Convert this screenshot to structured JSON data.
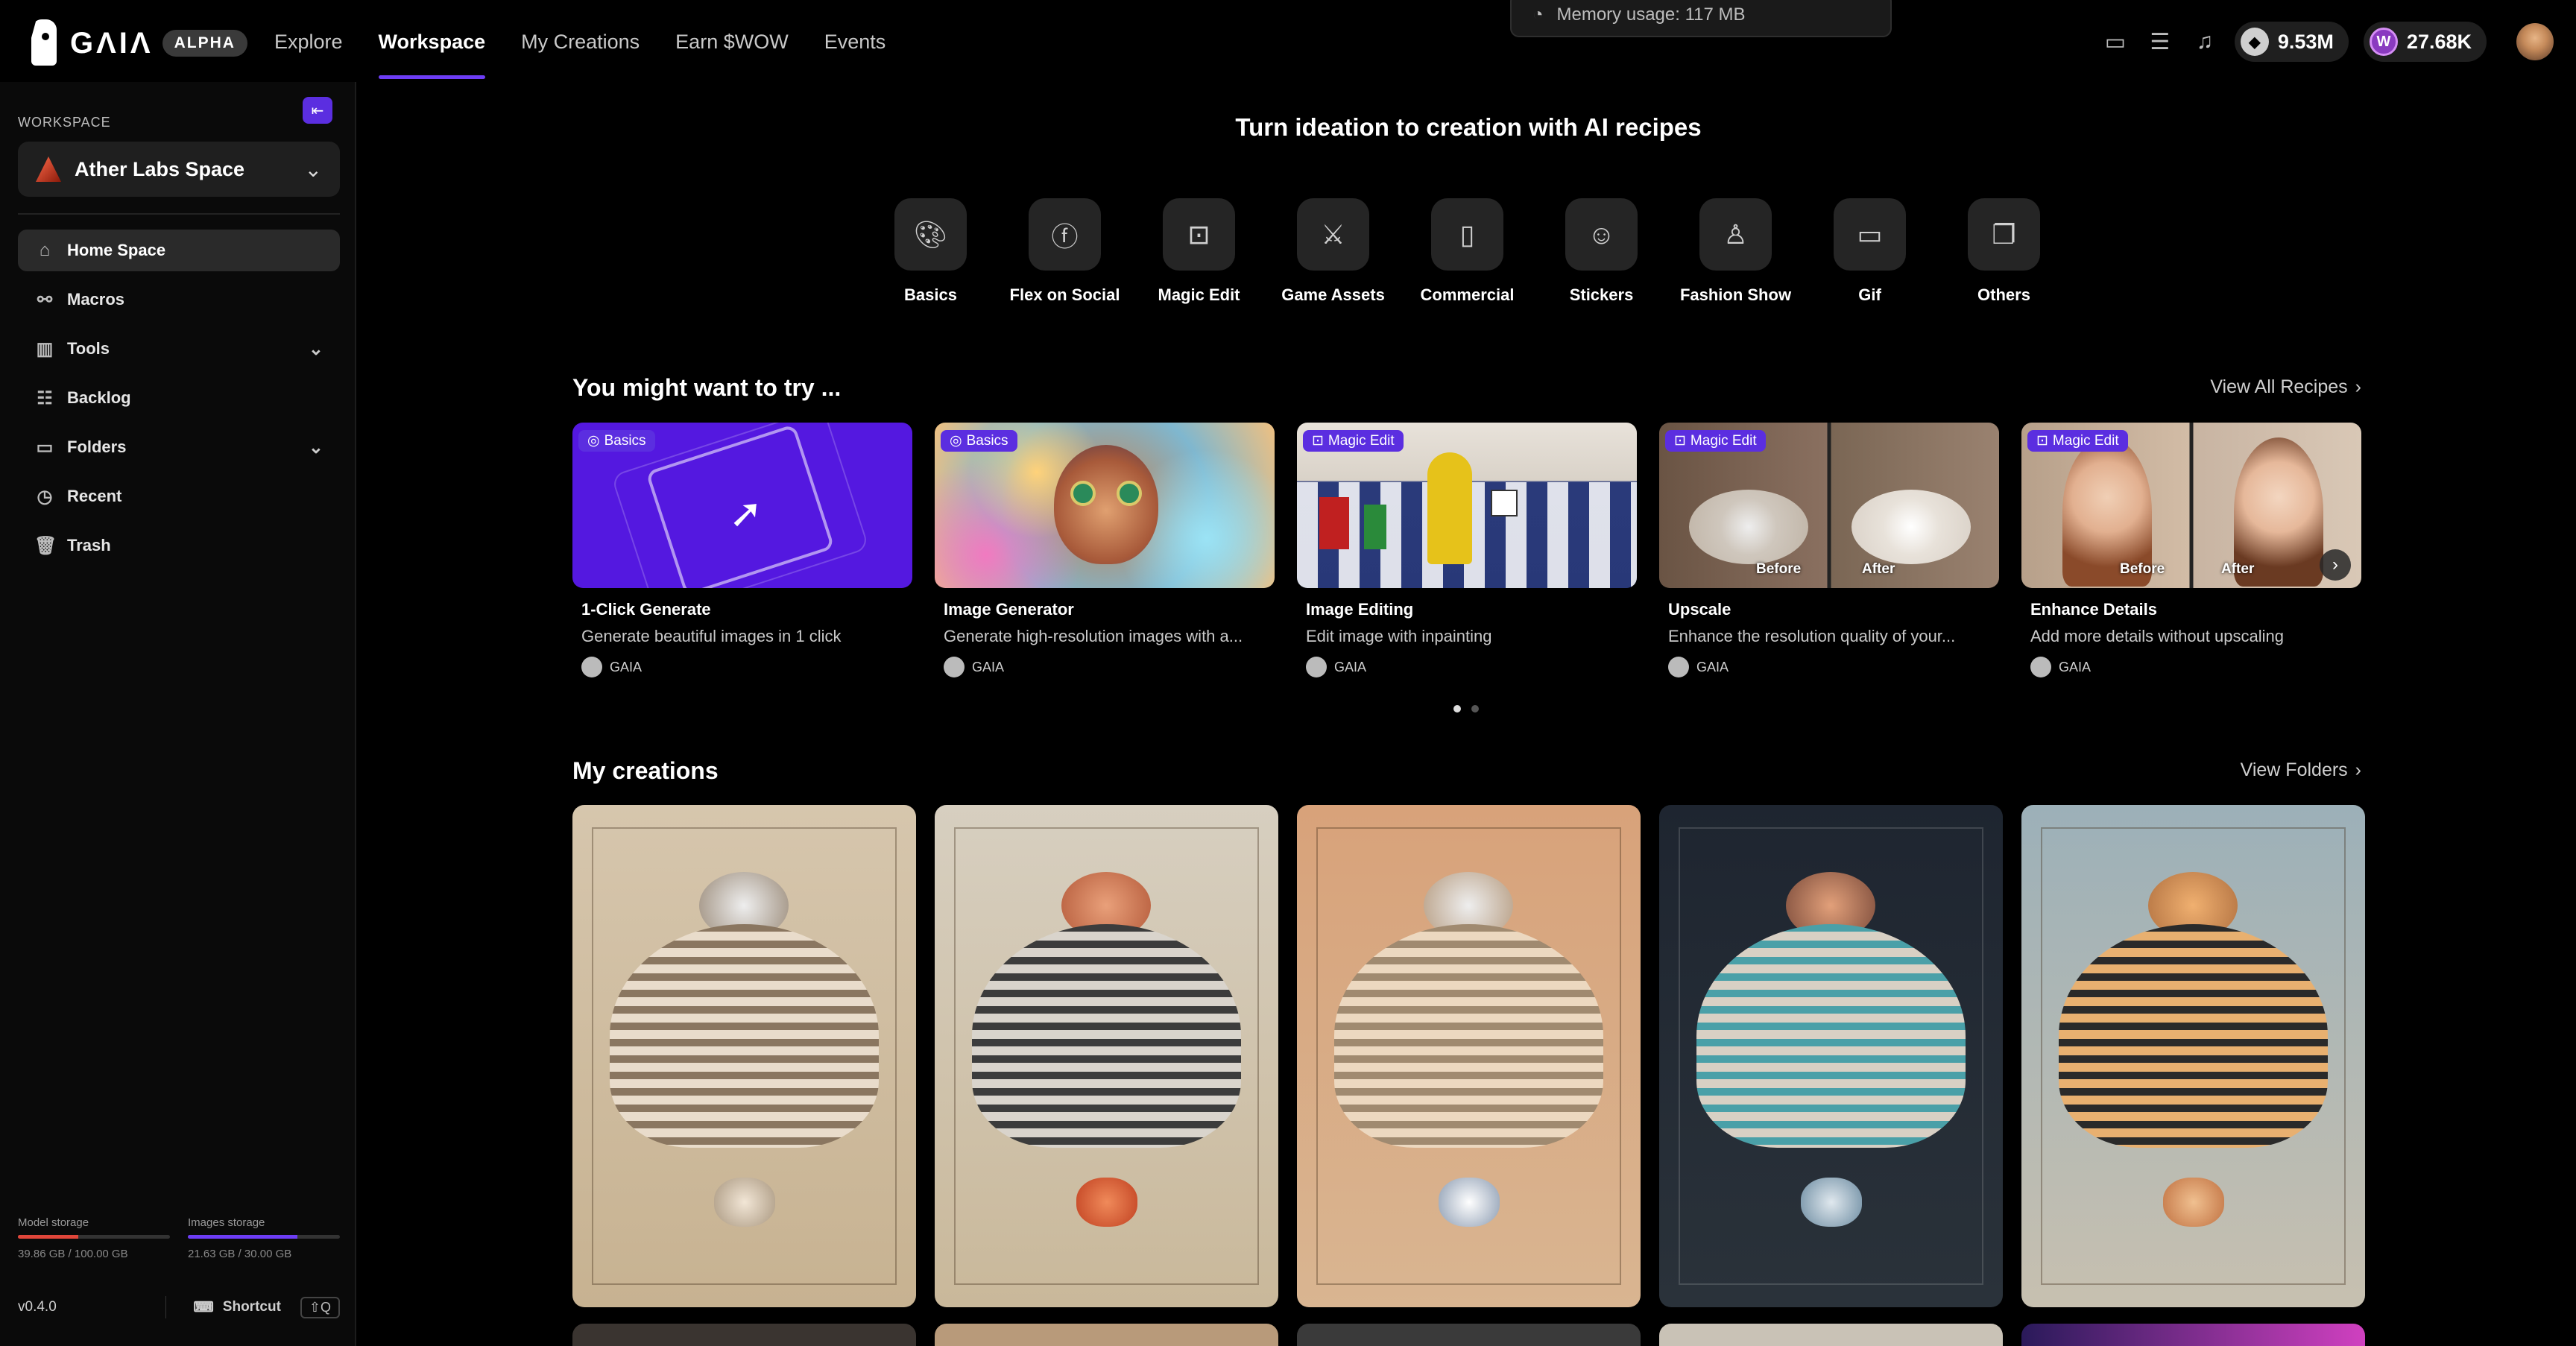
{
  "app": {
    "logo_text": "GΛIΛ",
    "badge": "ALPHA"
  },
  "nav": [
    {
      "label": "Explore",
      "active": false
    },
    {
      "label": "Workspace",
      "active": true
    },
    {
      "label": "My Creations",
      "active": false
    },
    {
      "label": "Earn $WOW",
      "active": false
    },
    {
      "label": "Events",
      "active": false
    }
  ],
  "toast": {
    "text": "Memory usage: 117 MB"
  },
  "balances": {
    "credits": "9.53M",
    "wow": "27.68K"
  },
  "sidebar": {
    "section_label": "WORKSPACE",
    "workspace_name": "Ather Labs Space",
    "items": [
      {
        "label": "Home Space",
        "icon": "home-icon",
        "active": true
      },
      {
        "label": "Macros",
        "icon": "macros-icon"
      },
      {
        "label": "Tools",
        "icon": "tools-icon",
        "expandable": true
      },
      {
        "label": "Backlog",
        "icon": "backlog-icon"
      },
      {
        "label": "Folders",
        "icon": "folder-icon",
        "expandable": true
      },
      {
        "label": "Recent",
        "icon": "clock-icon"
      },
      {
        "label": "Trash",
        "icon": "trash-icon"
      }
    ],
    "storage": {
      "model": {
        "label": "Model storage",
        "value": "39.86 GB / 100.00 GB",
        "fraction": 0.3986,
        "color": "#e0463a"
      },
      "images": {
        "label": "Images storage",
        "value": "21.63 GB / 30.00 GB",
        "fraction": 0.721,
        "color": "#6d3df5"
      }
    },
    "version": "v0.4.0",
    "shortcut_label": "Shortcut",
    "shortcut_key": "⇧Q"
  },
  "main": {
    "title": "Turn ideation to creation with AI recipes",
    "recipe_categories": [
      {
        "label": "Basics",
        "icon": "palette-icon"
      },
      {
        "label": "Flex on Social",
        "icon": "facebook-icon"
      },
      {
        "label": "Magic Edit",
        "icon": "magic-edit-icon"
      },
      {
        "label": "Game Assets",
        "icon": "sword-icon"
      },
      {
        "label": "Commercial",
        "icon": "commercial-icon"
      },
      {
        "label": "Stickers",
        "icon": "sticker-icon"
      },
      {
        "label": "Fashion Show",
        "icon": "hanger-icon"
      },
      {
        "label": "Gif",
        "icon": "video-icon"
      },
      {
        "label": "Others",
        "icon": "cards-icon"
      }
    ],
    "try_section": {
      "title": "You might want to try ...",
      "link": "View All Recipes",
      "cards": [
        {
          "tag": "Basics",
          "title": "1-Click Generate",
          "desc": "Generate beautiful images in 1 click",
          "author": "GAIA"
        },
        {
          "tag": "Basics",
          "title": "Image Generator",
          "desc": "Generate high-resolution images with a...",
          "author": "GAIA"
        },
        {
          "tag": "Magic Edit",
          "title": "Image Editing",
          "desc": "Edit image with inpainting",
          "author": "GAIA"
        },
        {
          "tag": "Magic Edit",
          "title": "Upscale",
          "desc": "Enhance the resolution quality of your...",
          "author": "GAIA",
          "before": "Before",
          "after": "After"
        },
        {
          "tag": "Magic Edit",
          "title": "Enhance Details",
          "desc": "Add more details without upscaling",
          "author": "GAIA",
          "before": "Before",
          "after": "After"
        }
      ]
    },
    "creations_section": {
      "title": "My creations",
      "link": "View Folders"
    }
  }
}
